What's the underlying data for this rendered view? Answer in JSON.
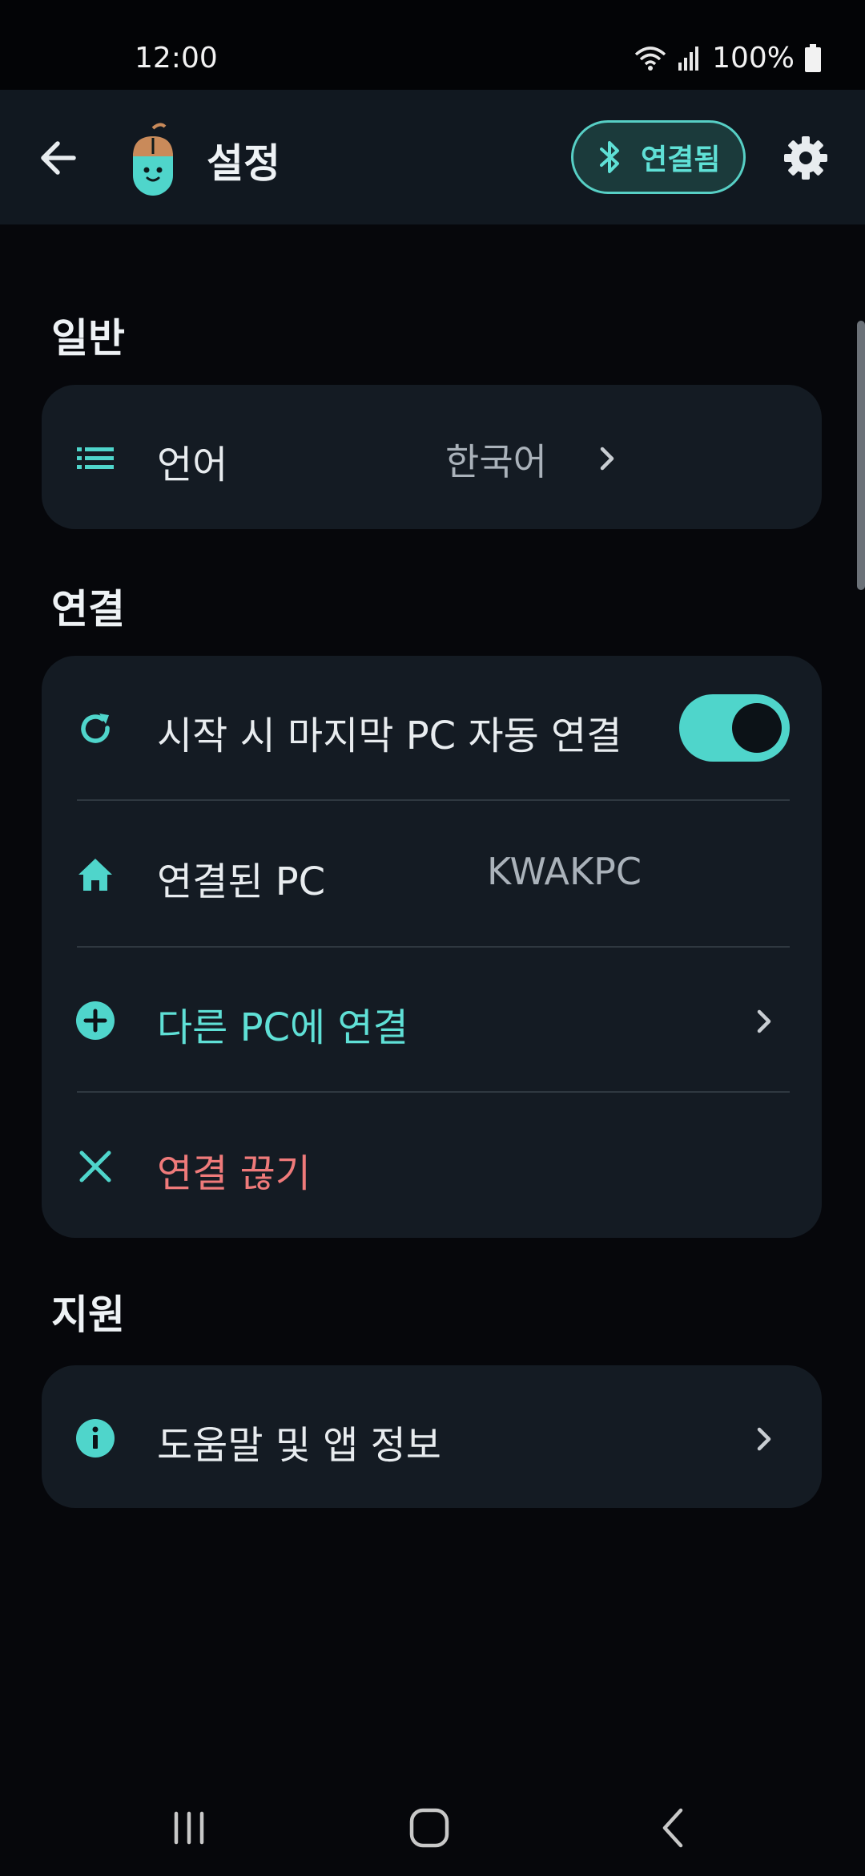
{
  "status_bar": {
    "time": "12:00",
    "battery": "100%"
  },
  "app_bar": {
    "title": "설정",
    "connection_status": "연결됨"
  },
  "sections": {
    "general": {
      "title": "일반",
      "language": {
        "label": "언어",
        "value": "한국어"
      }
    },
    "connection": {
      "title": "연결",
      "auto_connect": {
        "label": "시작 시 마지막 PC 자동 연결",
        "enabled": true
      },
      "connected_pc": {
        "label": "연결된 PC",
        "value": "KWAKPC"
      },
      "connect_other": {
        "label": "다른 PC에 연결"
      },
      "disconnect": {
        "label": "연결 끊기"
      }
    },
    "support": {
      "title": "지원",
      "help": {
        "label": "도움말 및 앱 정보"
      }
    }
  },
  "colors": {
    "accent": "#4fd5cb",
    "danger": "#ef7a7a",
    "background": "#06070b",
    "card": "#141b23"
  }
}
